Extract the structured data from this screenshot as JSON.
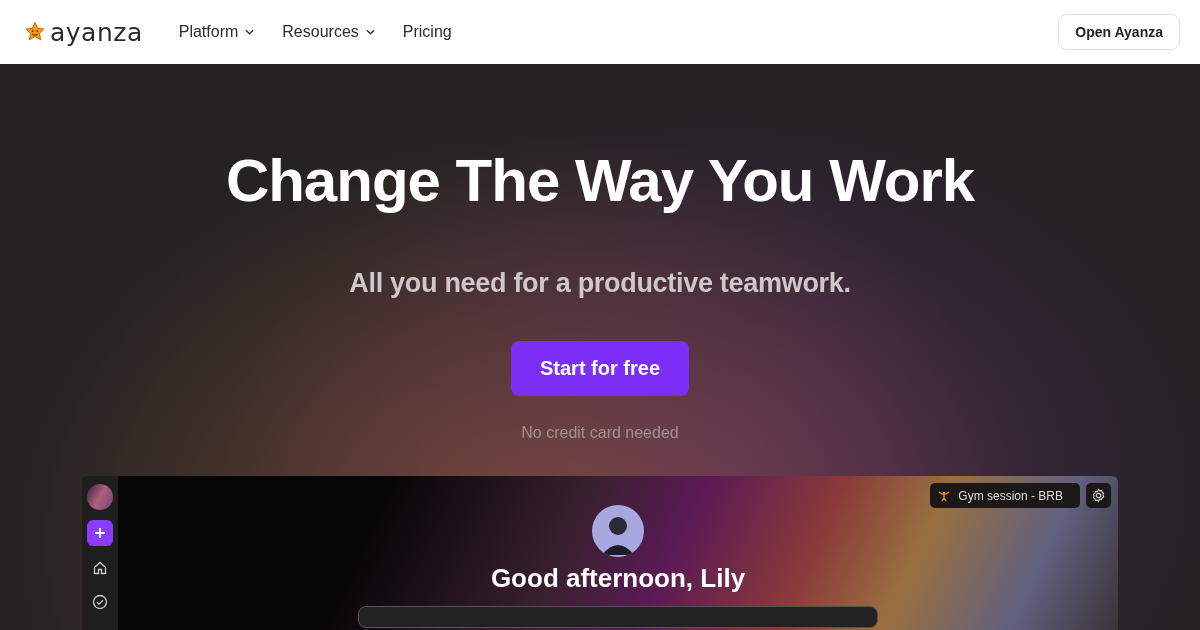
{
  "header": {
    "logo": "ayanza",
    "nav": [
      {
        "label": "Platform",
        "dropdown": true
      },
      {
        "label": "Resources",
        "dropdown": true
      },
      {
        "label": "Pricing",
        "dropdown": false
      }
    ],
    "cta": "Open Ayanza"
  },
  "hero": {
    "title": "Change The Way You Work",
    "subtitle": "All you need for a productive teamwork.",
    "button": "Start for free",
    "note": "No credit card needed"
  },
  "preview": {
    "status": "Gym session - BRB",
    "greeting": "Good afternoon, Lily"
  }
}
